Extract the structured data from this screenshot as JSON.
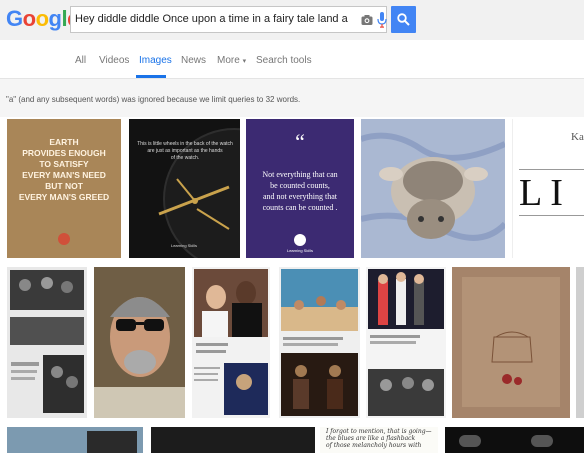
{
  "logo": {
    "text": "Google",
    "letters": [
      "G",
      "o",
      "o",
      "g",
      "l",
      "e"
    ],
    "colors": [
      "#4285f4",
      "#ea4335",
      "#fbbc05",
      "#4285f4",
      "#34a853",
      "#ea4335"
    ]
  },
  "search": {
    "query": "Hey diddle diddle   Once upon a time in a fairy tale land a cat and a do",
    "camera_icon": "camera-icon",
    "mic_icon": "mic-icon",
    "submit_icon": "search-icon"
  },
  "tabs": {
    "all": "All",
    "videos": "Videos",
    "images": "Images",
    "news": "News",
    "more": "More",
    "more_caret": "▾",
    "search_tools": "Search tools"
  },
  "notice": "\"a\" (and any subsequent words) was ignored because we limit queries to 32 words.",
  "results": {
    "earth": "EARTH\nPROVIDES ENOUGH\nTO SATISFY\nEVERY MAN'S NEED\nBUT NOT\nEVERY MAN'S GREED",
    "watch": "This is little wheels in the back of the watch\nare just as important as the hands\nof the watch.",
    "quote_mark": "“",
    "counts": "Not everything that can\nbe counted counts,\nand not everything that\ncounts can be counted .",
    "badge": "Learning Skills",
    "lif_top": "Ka",
    "lif": "LI",
    "handwriting": "I forgot to mention, that is going—\nthe blues are like a flashback\nof those melancholy hours with"
  },
  "colors": {
    "accent": "#1a73e8",
    "search_button": "#4285f4"
  }
}
